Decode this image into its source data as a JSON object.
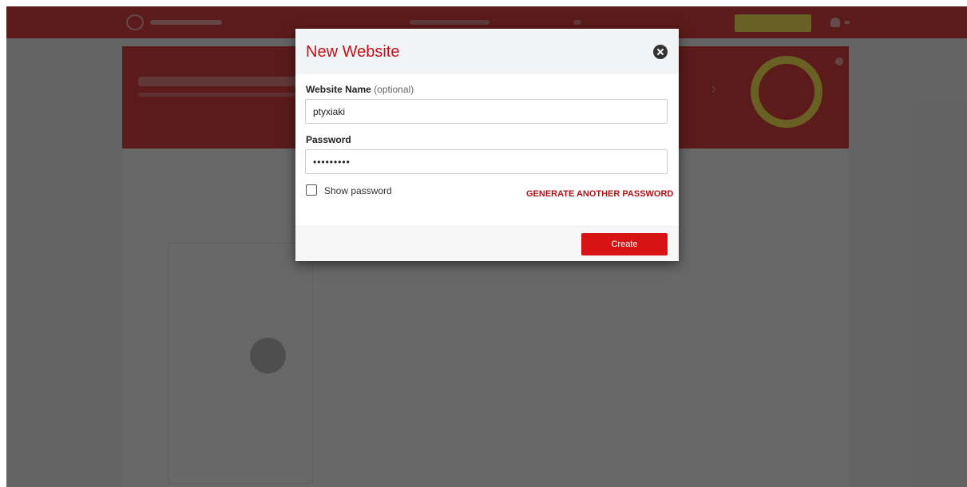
{
  "colors": {
    "brand_red": "#d41616",
    "title_red": "#c0111a",
    "link_red": "#b01118",
    "button_red": "#d81313",
    "accent_yellow": "#f5e12c",
    "overlay": "rgba(30,30,30,0.66)"
  },
  "modal": {
    "title": "New Website",
    "close_icon": "close-icon",
    "website_name": {
      "label": "Website Name",
      "hint": "(optional)",
      "value": "ptyxiaki"
    },
    "password": {
      "label": "Password",
      "value": "•••••••••"
    },
    "show_password": {
      "label": "Show password",
      "checked": false
    },
    "generate_link": "GENERATE ANOTHER PASSWORD",
    "create_button": "Create"
  }
}
